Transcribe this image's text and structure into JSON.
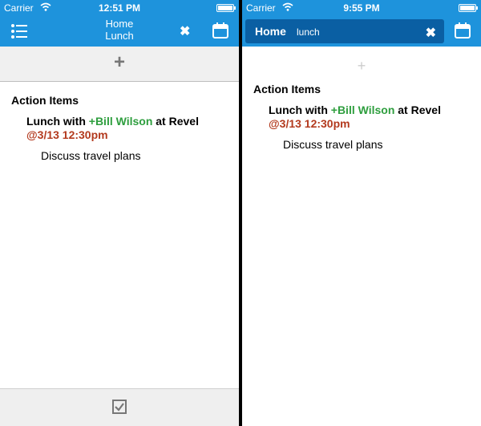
{
  "colors": {
    "bar": "#1E93DC",
    "search_bg": "#0A5FA3",
    "tag": "#2E9E3E",
    "date": "#B33A1E"
  },
  "left": {
    "status": {
      "carrier": "Carrier",
      "time": "12:51 PM",
      "battery_level": 1.0
    },
    "nav": {
      "title_line1": "Home",
      "title_line2": "Lunch",
      "menu_icon": "list-icon",
      "close_icon": "close-icon",
      "calendar_icon": "calendar-icon"
    },
    "add_icon": "plus-icon",
    "section_title": "Action Items",
    "item": {
      "prefix": "Lunch with ",
      "tag": "+Bill Wilson",
      "suffix": " at Revel",
      "date": "@3/13 12:30pm",
      "note": "Discuss travel plans"
    },
    "bottom_icon": "checkbox-icon"
  },
  "right": {
    "status": {
      "carrier": "Carrier",
      "time": "9:55 PM",
      "battery_level": 1.0
    },
    "search": {
      "scope": "Home",
      "query": "lunch",
      "clear_icon": "close-icon"
    },
    "calendar_icon": "calendar-icon",
    "add_icon": "plus-icon",
    "section_title": "Action Items",
    "item": {
      "prefix": "Lunch with ",
      "tag": "+Bill Wilson",
      "suffix": " at Revel",
      "date": "@3/13 12:30pm",
      "note": "Discuss travel plans"
    }
  }
}
